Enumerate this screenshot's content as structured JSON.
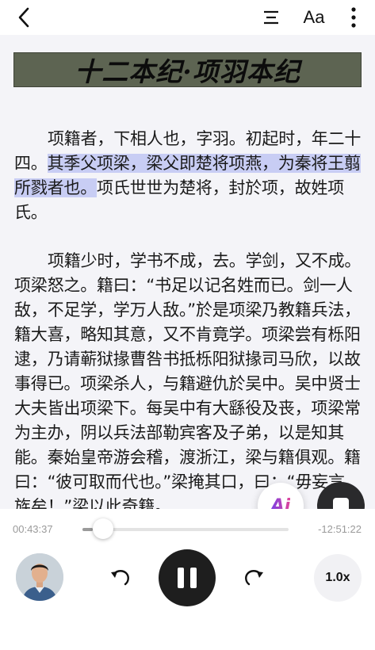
{
  "toolbar": {
    "back_icon": "chevron-left-icon",
    "toc_icon": "table-of-contents-icon",
    "font_label": "Aa",
    "more_icon": "more-vertical-icon"
  },
  "reader": {
    "chapter_title": "十二本纪·项羽本纪",
    "paragraph1": {
      "before": "项籍者，下相人也，字羽。初起时，年二十四。",
      "highlight": "其季父项梁，梁父即楚将项燕，为秦将王翦所戮者也。",
      "after": "项氏世世为楚将，封於项，故姓项氏。"
    },
    "paragraph2": "项籍少时，学书不成，去。学剑，又不成。项梁怒之。籍曰：“书足以记名姓而已。剑一人敌，不足学，学万人敌。”於是项梁乃教籍兵法，籍大喜，略知其意，又不肯竟学。项梁尝有栎阳逮，乃请蕲狱掾曹咎书抵栎阳狱掾司马欣，以故事得已。项梁杀人，与籍避仇於吴中。吴中贤士大夫皆出项梁下。每吴中有大繇役及丧，项梁常为主办，阴以兵法部勒宾客及子弟，以是知其能。秦始皇帝游会稽，渡浙江，梁与籍俱观。籍曰：“彼可取而代也。”梁掩其口，曰：“毋妄言，族矣！”梁以此奇籍。"
  },
  "floating": {
    "ai_label": "Ai",
    "stop_icon": "stop-icon"
  },
  "player": {
    "elapsed": "00:43:37",
    "remaining": "-12:51:22",
    "progress": 0.05,
    "rewind_icon": "rewind-icon",
    "pause_icon": "pause-icon",
    "forward_icon": "forward-icon",
    "speed": "1.0x",
    "avatar_icon": "narrator-avatar"
  }
}
